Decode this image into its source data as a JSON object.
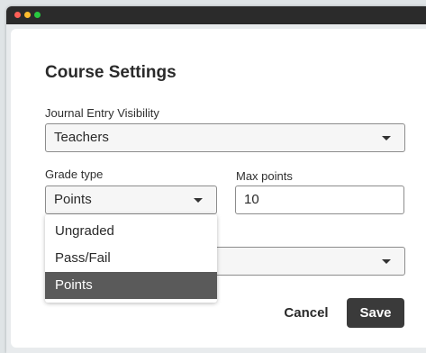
{
  "window": {
    "controls": [
      "close",
      "minimize",
      "zoom"
    ]
  },
  "dialog": {
    "title": "Course Settings",
    "journal_visibility": {
      "label": "Journal Entry Visibility",
      "value": "Teachers"
    },
    "grade_type": {
      "label": "Grade type",
      "value": "Points",
      "options": [
        "Ungraded",
        "Pass/Fail",
        "Points"
      ],
      "selected_index": 2
    },
    "max_points": {
      "label": "Max points",
      "value": "10"
    },
    "buttons": {
      "cancel": "Cancel",
      "save": "Save"
    }
  },
  "colors": {
    "save_button": "#3a3a3a",
    "selected_option": "#5a5a5a",
    "titlebar": "#2b2b2b"
  }
}
